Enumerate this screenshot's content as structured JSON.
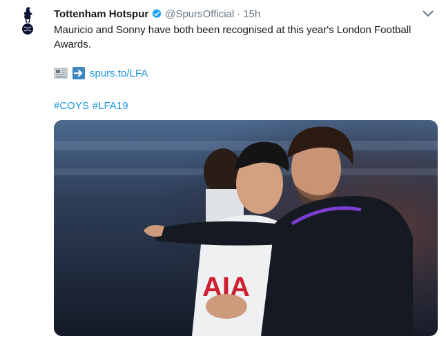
{
  "tweet": {
    "author_name": "Tottenham Hotspur",
    "handle": "@SpursOfficial",
    "separator": "·",
    "timestamp": "15h",
    "text": "Mauricio and Sonny have both been recognised at this year's London Football Awards.",
    "link_text": "spurs.to/LFA",
    "hashtags": [
      "#COYS",
      "#LFA19"
    ],
    "photo_shirt_text": "AIA"
  },
  "icons": {
    "avatar": "cockerel-crest-icon",
    "verified": "verified-badge-icon",
    "caret": "chevron-down-icon",
    "newspaper": "newspaper-emoji-icon",
    "arrow": "right-arrow-emoji-icon"
  },
  "colors": {
    "link": "#1b95e0",
    "text": "#14171a",
    "secondary": "#657786",
    "verified": "#1da1f2"
  }
}
